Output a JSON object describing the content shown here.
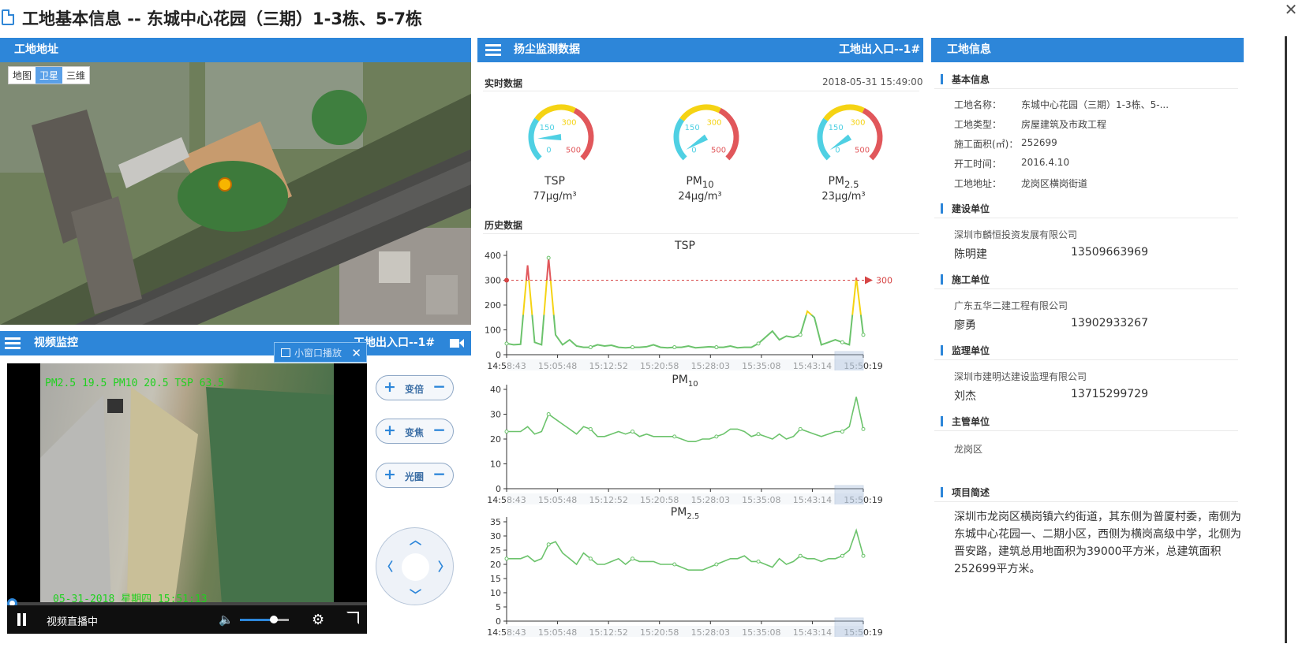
{
  "page": {
    "title": "工地基本信息 -- 东城中心花园（三期）1-3栋、5-7栋",
    "close": "✕"
  },
  "address_panel": {
    "title": "工地地址",
    "map_types": [
      "地图",
      "卫星",
      "三维"
    ],
    "active_map_type": "卫星"
  },
  "video_panel": {
    "title": "视频监控",
    "camera": "工地出入口--1#",
    "pip_label": "小窗口播放",
    "osd_top": "PM2.5 19.5 PM10 20.5 TSP 63.5",
    "osd_bottom": "05-31-2018 星期四 15:51:13",
    "status": "视频直播中",
    "volume": 0.7,
    "controls": [
      {
        "plus": "+",
        "label": "变倍",
        "minus": "−"
      },
      {
        "plus": "+",
        "label": "变焦",
        "minus": "−"
      },
      {
        "plus": "+",
        "label": "光圈",
        "minus": "−"
      }
    ],
    "ptz": {
      "up": "︿",
      "down": "﹀",
      "left": "〈",
      "right": "〉"
    }
  },
  "dust_panel": {
    "title": "扬尘监测数据",
    "location": "工地出入口--1#",
    "realtime_label": "实时数据",
    "timestamp": "2018-05-31 15:49:00",
    "history_label": "历史数据",
    "gauge_ticks": [
      "0",
      "150",
      "300",
      "500"
    ],
    "gauges": [
      {
        "name": "TSP",
        "sub": "",
        "value": "77μg/m³",
        "level": 77
      },
      {
        "name": "PM",
        "sub": "10",
        "value": "24μg/m³",
        "level": 24
      },
      {
        "name": "PM",
        "sub": "2.5",
        "value": "23μg/m³",
        "level": 23
      }
    ],
    "colors": {
      "green": "#6cc36c",
      "yellow": "#f5d313",
      "red": "#e1575b",
      "cyan": "#4fd0e3"
    }
  },
  "chart_data": [
    {
      "type": "line",
      "title": "TSP",
      "title_sub": "",
      "x": [
        "14:58:43",
        "15:05:48",
        "15:12:52",
        "15:20:58",
        "15:28:03",
        "15:35:08",
        "15:43:14",
        "15:50:19"
      ],
      "ylim": [
        0,
        400
      ],
      "yticks": [
        "0",
        "100",
        "200",
        "300",
        "400"
      ],
      "markline": {
        "value": 300,
        "label": "300"
      },
      "values": [
        45,
        40,
        42,
        360,
        50,
        40,
        390,
        80,
        40,
        60,
        35,
        30,
        30,
        40,
        35,
        38,
        30,
        28,
        30,
        30,
        32,
        40,
        30,
        28,
        30,
        30,
        35,
        28,
        30,
        32,
        30,
        30,
        35,
        28,
        30,
        30,
        45,
        70,
        95,
        60,
        75,
        70,
        80,
        175,
        150,
        40,
        50,
        60,
        50,
        40,
        310,
        80
      ]
    },
    {
      "type": "line",
      "title": "PM",
      "title_sub": "10",
      "x": [
        "14:58:43",
        "15:05:48",
        "15:12:52",
        "15:20:58",
        "15:28:03",
        "15:35:08",
        "15:43:14",
        "15:50:19"
      ],
      "ylim": [
        0,
        40
      ],
      "yticks": [
        "0",
        "10",
        "20",
        "30",
        "40"
      ],
      "values": [
        23,
        23,
        23,
        25,
        22,
        23,
        30,
        28,
        26,
        24,
        22,
        25,
        24,
        21,
        21,
        22,
        23,
        22,
        23,
        21,
        22,
        21,
        21,
        21,
        21,
        20,
        19,
        19,
        20,
        20,
        21,
        22,
        24,
        24,
        23,
        21,
        22,
        21,
        20,
        22,
        20,
        21,
        24,
        23,
        22,
        21,
        22,
        23,
        23,
        25,
        37,
        24
      ]
    },
    {
      "type": "line",
      "title": "PM",
      "title_sub": "2.5",
      "x": [
        "14:58:43",
        "15:05:48",
        "15:12:52",
        "15:20:58",
        "15:28:03",
        "15:35:08",
        "15:43:14",
        "15:50:19"
      ],
      "ylim": [
        0,
        35
      ],
      "yticks": [
        "0",
        "5",
        "10",
        "15",
        "20",
        "25",
        "30",
        "35"
      ],
      "values": [
        22,
        22,
        22,
        23,
        21,
        22,
        27,
        28,
        24,
        22,
        20,
        24,
        22,
        20,
        20,
        21,
        22,
        20,
        22,
        21,
        21,
        21,
        20,
        20,
        20,
        19,
        18,
        18,
        18,
        19,
        20,
        21,
        22,
        22,
        23,
        21,
        21,
        20,
        19,
        22,
        20,
        21,
        23,
        22,
        22,
        21,
        22,
        22,
        23,
        25,
        32,
        23
      ]
    }
  ],
  "info_panel": {
    "title": "工地信息",
    "basic": {
      "label": "基本信息",
      "rows": [
        {
          "k": "工地名称：",
          "v": "东城中心花园（三期）1-3栋、5-..."
        },
        {
          "k": "工地类型：",
          "v": "房屋建筑及市政工程"
        },
        {
          "k": "施工面积(㎡)：",
          "v": "252699"
        },
        {
          "k": "开工时间：",
          "v": "2016.4.10"
        },
        {
          "k": "工地地址：",
          "v": "龙岗区横岗街道"
        }
      ]
    },
    "builder": {
      "label": "建设单位",
      "org": "深圳市麟恒投资发展有限公司",
      "person": "陈明建",
      "phone": "13509663969"
    },
    "contractor": {
      "label": "施工单位",
      "org": "广东五华二建工程有限公司",
      "person": "廖勇",
      "phone": "13902933267"
    },
    "supervisor": {
      "label": "监理单位",
      "org": "深圳市建明达建设监理有限公司",
      "person": "刘杰",
      "phone": "13715299729"
    },
    "authority": {
      "label": "主管单位",
      "org": "龙岗区"
    },
    "project": {
      "label": "项目简述",
      "text": "深圳市龙岗区横岗镇六约街道，其东侧为普厦村委，南侧为东城中心花园一、二期小区，西侧为横岗高级中学，北侧为晋安路，建筑总用地面积为39000平方米，总建筑面积252699平方米。"
    }
  }
}
